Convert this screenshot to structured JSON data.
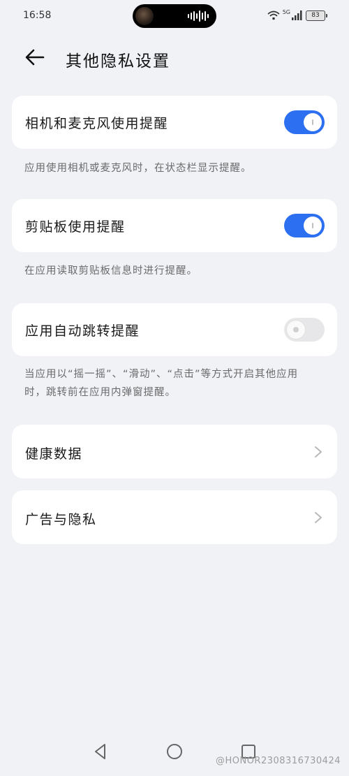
{
  "status": {
    "time": "16:58",
    "network": "5G",
    "battery": "83"
  },
  "header": {
    "title": "其他隐私设置"
  },
  "settings": [
    {
      "label": "相机和麦克风使用提醒",
      "enabled": true,
      "desc": "应用使用相机或麦克风时，在状态栏显示提醒。"
    },
    {
      "label": "剪贴板使用提醒",
      "enabled": true,
      "desc": "在应用读取剪贴板信息时进行提醒。"
    },
    {
      "label": "应用自动跳转提醒",
      "enabled": false,
      "desc": "当应用以“摇一摇”、“滑动”、“点击”等方式开启其他应用时，跳转前在应用内弹窗提醒。"
    }
  ],
  "links": [
    {
      "label": "健康数据"
    },
    {
      "label": "广告与隐私"
    }
  ],
  "watermark": "@HONOR2308316730424",
  "colors": {
    "accent": "#2c6ff0",
    "background": "#f1f2f6",
    "card": "#ffffff"
  }
}
